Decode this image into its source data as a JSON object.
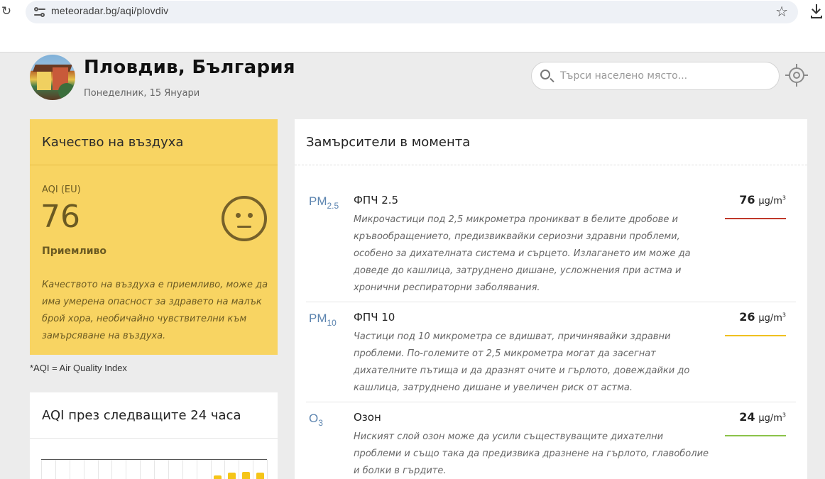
{
  "browser": {
    "url": "meteoradar.bg/aqi/plovdiv"
  },
  "header": {
    "city": "Пловдив, България",
    "date": "Понеделник, 15 Януари",
    "search_placeholder": "Търси населено място..."
  },
  "aqi_card": {
    "title": "Качество на въздуха",
    "index_label": "AQI (EU)",
    "value": "76",
    "level": "Приемливо",
    "description": "Качеството на въздуха е приемливо, може да има умерена опасност за здравето на малък брой хора, необичайно чувствителни към замърсяване на въздуха.",
    "color": "#f8d462"
  },
  "footnote": "*AQI = Air Quality Index",
  "forecast": {
    "title": "AQI през следващите 24 часа",
    "bar_color": "#f5c518",
    "levels": [
      0,
      0,
      0,
      0,
      0,
      0,
      0,
      0,
      0,
      0,
      0,
      0,
      0.18,
      0.32,
      0.36,
      0.32
    ]
  },
  "pollutants": {
    "title": "Замърсители в момента",
    "unit": "µg/m",
    "unit_sup": "3",
    "items": [
      {
        "symbol": "PM",
        "symbol_sub": "2.5",
        "name": "ФПЧ 2.5",
        "value": "76",
        "level_color": "#c0392b",
        "description": "Микрочастици под 2,5 микрометра проникват в белите дробове и кръвообращението, предизвиквайки сериозни здравни проблеми, особено за дихателната система и сърцето. Излагането им може да доведе до кашлица, затруднено дишане, усложнения при астма и хронични респираторни заболявания."
      },
      {
        "symbol": "PM",
        "symbol_sub": "10",
        "name": "ФПЧ 10",
        "value": "26",
        "level_color": "#f0c020",
        "description": "Частици под 10 микрометра се вдишват, причинявайки здравни проблеми. По-големите от 2,5 микрометра могат да засегнат дихателните пътища и да дразнят очите и гърлото, довеждайки до кашлица, затруднено дишане и увеличен риск от астма."
      },
      {
        "symbol": "O",
        "symbol_sub": "3",
        "name": "Озон",
        "value": "24",
        "level_color": "#8bc34a",
        "description": "Ниският слой озон може да усили съществуващите дихателни проблеми и също така да предизвика дразнене на гърлото, главоболие и болки в гърдите."
      }
    ]
  }
}
